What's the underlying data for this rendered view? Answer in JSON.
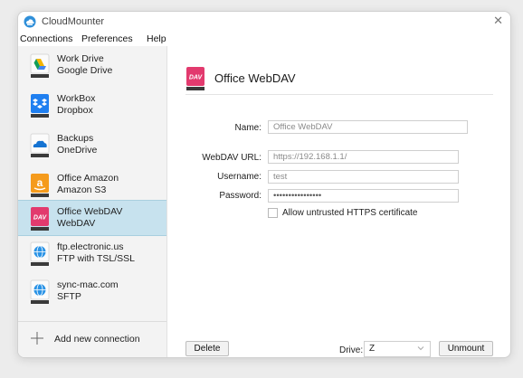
{
  "app": {
    "title": "CloudMounter"
  },
  "menu": [
    "Connections",
    "Preferences",
    "Help"
  ],
  "connections": [
    {
      "line1": "Work Drive",
      "line2": "Google Drive",
      "icon": "google-drive-icon"
    },
    {
      "line1": "WorkBox",
      "line2": "Dropbox",
      "icon": "dropbox-icon"
    },
    {
      "line1": "Backups",
      "line2": "OneDrive",
      "icon": "onedrive-icon"
    },
    {
      "line1": "Office Amazon",
      "line2": "Amazon S3",
      "icon": "amazon-s3-icon"
    },
    {
      "line1": "Office WebDAV",
      "line2": "WebDAV",
      "icon": "webdav-icon"
    },
    {
      "line1": "ftp.electronic.us",
      "line2": "FTP with TSL/SSL",
      "icon": "ftp-globe-icon"
    },
    {
      "line1": "sync-mac.com",
      "line2": "SFTP",
      "icon": "sftp-globe-icon"
    }
  ],
  "selected_index": 4,
  "add_connection_label": "Add new connection",
  "detail": {
    "title": "Office WebDAV",
    "icon_text": "DAV",
    "fields": {
      "name": {
        "label": "Name:",
        "value": "Office WebDAV"
      },
      "url": {
        "label": "WebDAV URL:",
        "value": "https://192.168.1.1/"
      },
      "username": {
        "label": "Username:",
        "value": "test"
      },
      "password": {
        "label": "Password:",
        "value": "••••••••••••••••"
      }
    },
    "untrusted_label": "Allow untrusted HTTPS certificate",
    "untrusted_checked": false
  },
  "footer": {
    "delete_label": "Delete",
    "drive_label": "Drive:",
    "drive_value": "Z",
    "unmount_label": "Unmount"
  },
  "colors": {
    "selection": "#c7e2ee",
    "webdav_brand": "#e23a6e",
    "google_yellow": "#f4b400",
    "dropbox_blue": "#1f7ff0",
    "onedrive_blue": "#1473d2",
    "amazon_orange": "#f59b1c",
    "globe_blue": "#2a93e6"
  }
}
